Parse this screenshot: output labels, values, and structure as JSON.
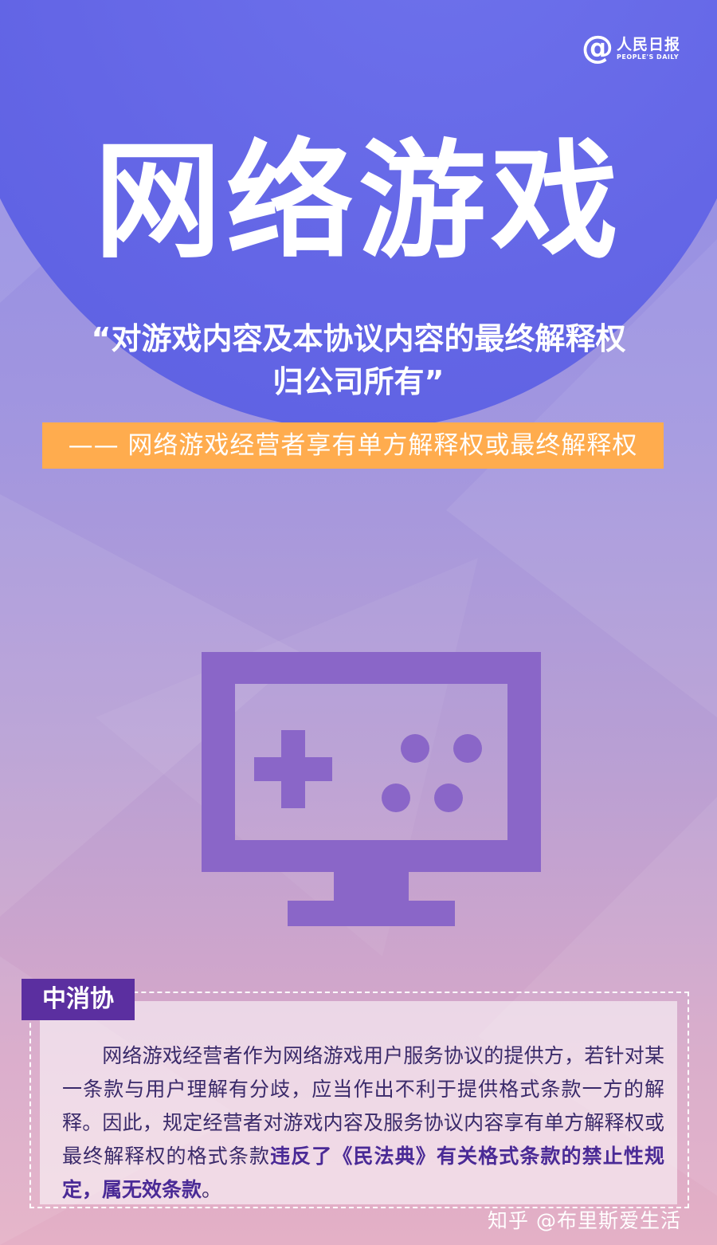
{
  "brand": {
    "cn": "人民日报",
    "en": "PEOPLE'S DAILY"
  },
  "title": "网络游戏",
  "quote": {
    "line1": "“对游戏内容及本协议内容的最终解释权",
    "line2": "归公司所有”"
  },
  "subtitle": "—— 网络游戏经营者享有单方解释权或最终解释权",
  "illustration": {
    "icon": "game-monitor-icon"
  },
  "source_tag": "中消协",
  "body": {
    "normal": "网络游戏经营者作为网络游戏用户服务协议的提供方，若针对某一条款与用户理解有分歧，应当作出不利于提供格式条款一方的解释。因此，规定经营者对游戏内容及服务协议内容享有单方解释权或最终解释权的格式条款",
    "bold": "违反了《民法典》有关格式条款的禁止性规定，属无效条款",
    "end": "。"
  },
  "watermark": "知乎 @布里斯爱生活",
  "colors": {
    "accent": "#ffac4e",
    "tag": "#5b2fa0",
    "icon": "#8a66c8",
    "circle": "#6466e6"
  }
}
